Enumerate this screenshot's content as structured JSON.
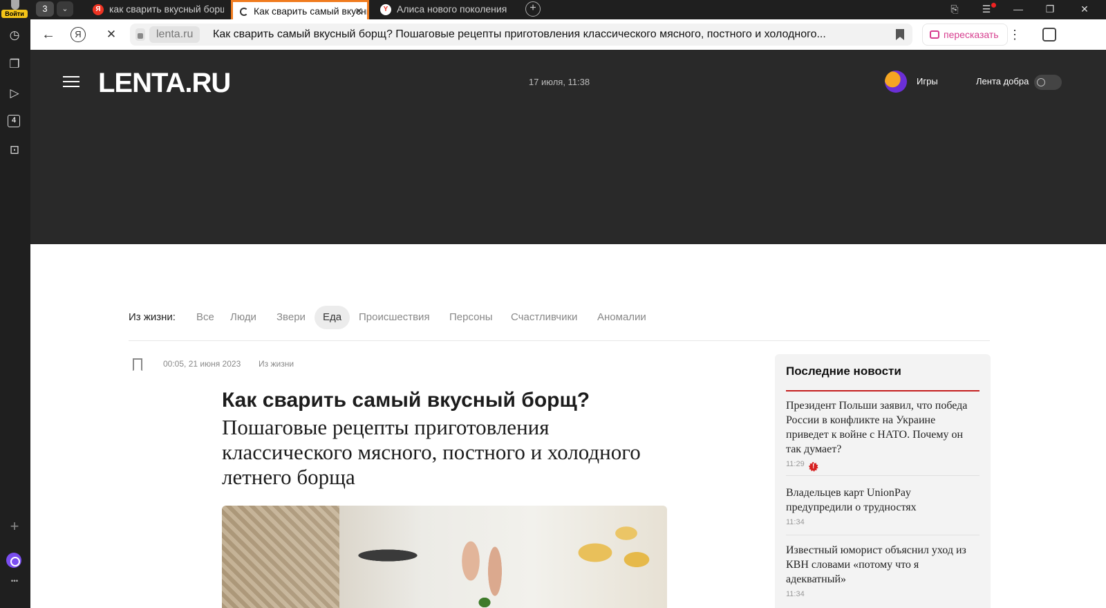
{
  "browser": {
    "login_label": "Войти",
    "tab_count": "3",
    "tabs": [
      {
        "title": "как сварить вкусный борщ",
        "favicon": "Я"
      },
      {
        "title": "Как сварить самый вкусный",
        "favicon": "loading"
      },
      {
        "title": "Алиса нового поколения",
        "favicon": "Y"
      }
    ],
    "new_tab_label": "+",
    "window_controls": {
      "minimize": "—",
      "restore": "❐",
      "close": "✕"
    },
    "accent_color": "#f07b1e"
  },
  "addressbar": {
    "back": "←",
    "yandex": "Я",
    "stop": "✕",
    "domain": "lenta.ru",
    "page_title": "Как сварить самый вкусный борщ? Пошаговые рецепты приготовления классического мясного, постного и холодного...",
    "retell_label": "пересказать",
    "more": "⋮"
  },
  "sidebar": {
    "icons": [
      "history-icon",
      "collections-icon",
      "video-icon",
      "counter-icon",
      "screenshot-icon"
    ],
    "counter_value": "4",
    "add": "+",
    "more": "•••"
  },
  "site": {
    "logo": "LENTA.RU",
    "date": "17 июля, 11:38",
    "games_label": "Игры",
    "kind_feed_label": "Лента добра",
    "kind_feed_enabled": false
  },
  "categories": {
    "label": "Из жизни:",
    "items": [
      "Все",
      "Люди",
      "Звери",
      "Еда",
      "Происшествия",
      "Персоны",
      "Счастливчики",
      "Аномалии"
    ],
    "active": "Еда"
  },
  "article": {
    "datetime": "00:05, 21 июня 2023",
    "rubric": "Из жизни",
    "title": "Как сварить самый вкусный борщ?",
    "subtitle": "Пошаговые рецепты приготовления классического мясного, постного и холодного летнего борща"
  },
  "latest_news": {
    "heading": "Последние новости",
    "items": [
      {
        "title": "Президент Польши заявил, что победа России в конфликте на Украине приведет к войне с НАТО. Почему он так думает?",
        "time": "11:29",
        "hot": true
      },
      {
        "title": "Владельцев карт UnionPay предупредили о трудностях",
        "time": "11:34",
        "hot": false
      },
      {
        "title": "Известный юморист объяснил уход из КВН словами «потому что я адекватный»",
        "time": "11:34",
        "hot": false
      }
    ]
  }
}
